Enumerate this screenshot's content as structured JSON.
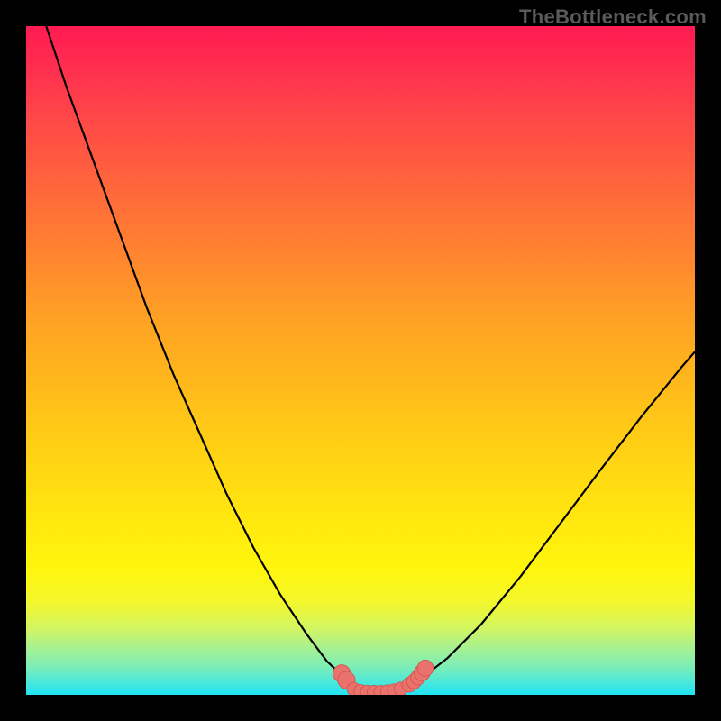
{
  "watermark": "TheBottleneck.com",
  "colors": {
    "page_bg": "#000000",
    "curve_stroke": "#000000",
    "marker_fill": "#e9726c",
    "marker_stroke": "#d2504b",
    "gradient_top": "#ff1b52",
    "gradient_bottom": "#1fe3f4"
  },
  "chart_data": {
    "type": "line",
    "title": "",
    "xlabel": "",
    "ylabel": "",
    "xlim": [
      0,
      100
    ],
    "ylim": [
      0,
      100
    ],
    "grid": false,
    "legend": false,
    "series": [
      {
        "name": "bottleneck-curve",
        "x": [
          3,
          6,
          10,
          14,
          18,
          22,
          26,
          30,
          34,
          38,
          42,
          45,
          47.5,
          49,
          50,
          51,
          52,
          53,
          54,
          56,
          59,
          63,
          68,
          74,
          80,
          86,
          92,
          98,
          100
        ],
        "values": [
          100,
          91,
          80,
          69,
          58,
          48,
          39,
          30,
          22,
          15,
          9,
          5,
          2.7,
          1.4,
          0.8,
          0.5,
          0.4,
          0.4,
          0.5,
          0.9,
          2.4,
          5.5,
          10.5,
          17.8,
          25.8,
          33.8,
          41.6,
          49,
          51.3
        ]
      }
    ],
    "markers": [
      {
        "x": 47.2,
        "y": 3.2,
        "r": 1.3
      },
      {
        "x": 47.9,
        "y": 2.2,
        "r": 1.3
      },
      {
        "x": 49.0,
        "y": 0.85,
        "r": 1.0
      },
      {
        "x": 50.0,
        "y": 0.55,
        "r": 1.0
      },
      {
        "x": 51.0,
        "y": 0.45,
        "r": 1.0
      },
      {
        "x": 52.0,
        "y": 0.42,
        "r": 1.0
      },
      {
        "x": 53.0,
        "y": 0.42,
        "r": 1.0
      },
      {
        "x": 54.0,
        "y": 0.5,
        "r": 1.0
      },
      {
        "x": 55.0,
        "y": 0.65,
        "r": 1.0
      },
      {
        "x": 56.0,
        "y": 0.9,
        "r": 1.0
      },
      {
        "x": 57.3,
        "y": 1.5,
        "r": 1.1
      },
      {
        "x": 58.0,
        "y": 2.0,
        "r": 1.1
      },
      {
        "x": 58.6,
        "y": 2.6,
        "r": 1.1
      },
      {
        "x": 59.2,
        "y": 3.3,
        "r": 1.2
      },
      {
        "x": 59.7,
        "y": 4.0,
        "r": 1.2
      }
    ]
  }
}
